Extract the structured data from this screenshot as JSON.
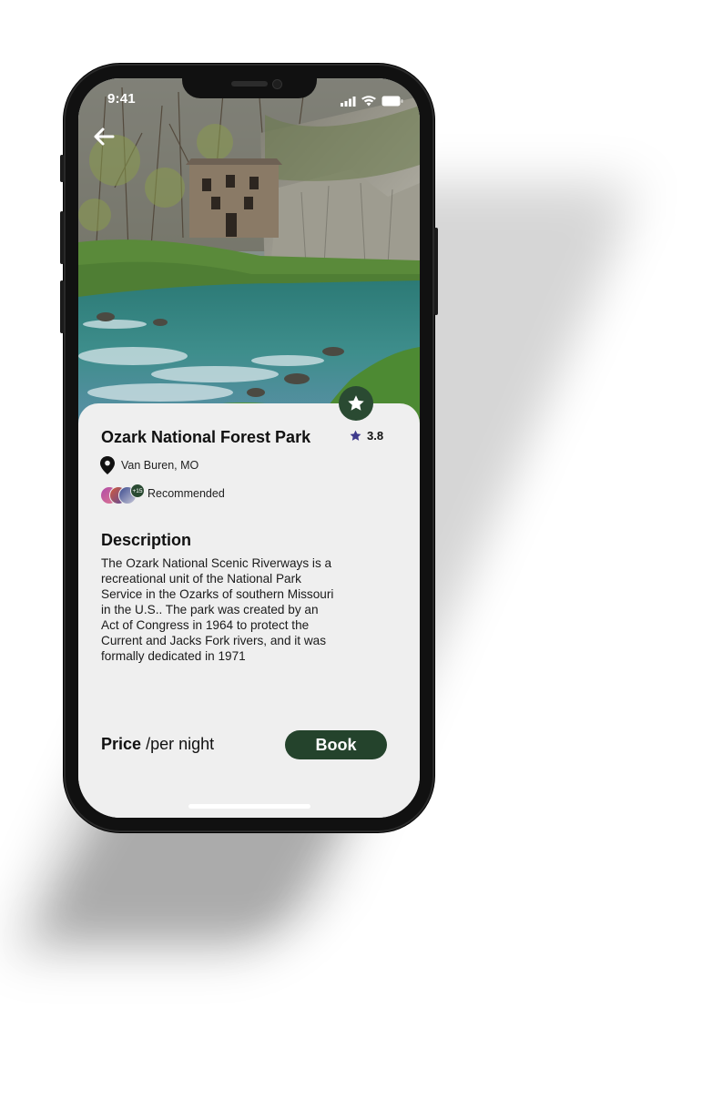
{
  "status_bar": {
    "time": "9:41",
    "icons": [
      "signal-icon",
      "wifi-icon",
      "battery-icon"
    ]
  },
  "nav": {
    "back_icon": "arrow-left-icon"
  },
  "park": {
    "name": "Ozark National Forest Park",
    "rating": "3.8",
    "location": "Van Buren, MO",
    "recommended_label": "Recommended",
    "recommended_extra_count": "+15"
  },
  "description": {
    "heading": "Description",
    "lines": [
      "The Ozark National Scenic Riverways is a",
      "recreational unit of the National Park",
      "Service in the Ozarks of southern Missouri",
      "in the U.S.. The park was created by an",
      "Act of Congress in 1964 to protect the",
      "Current and Jacks Fork rivers, and it was",
      "formally dedicated in 1971"
    ]
  },
  "booking": {
    "price_label": "Price",
    "price_unit": "/per night",
    "book_label": "Book"
  },
  "colors": {
    "accent_green": "#24432c",
    "star_purple": "#3e3a8c",
    "sheet_bg": "#efefef"
  }
}
